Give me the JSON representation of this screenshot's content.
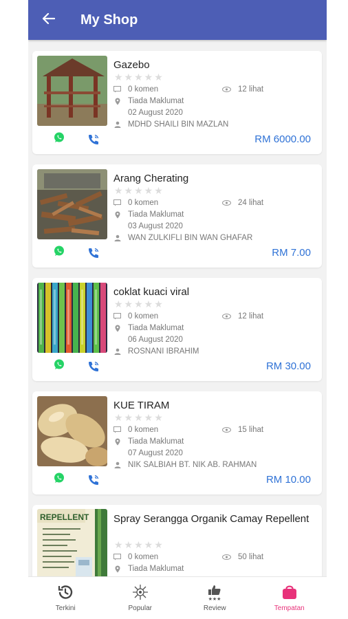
{
  "appbar": {
    "title": "My Shop",
    "back_icon": "arrow-left-icon"
  },
  "colors": {
    "appbar": "#4d5eb5",
    "price": "#2f72d6",
    "whatsapp": "#25d366",
    "call": "#2f72d6",
    "active_tab": "#e8327a"
  },
  "products": [
    {
      "name": "Gazebo",
      "comments": "0 komen",
      "views": "12 lihat",
      "location": "Tiada Maklumat",
      "date": "02 August 2020",
      "seller": "MDHD SHAILI BIN MAZLAN",
      "price": "RM 6000.00"
    },
    {
      "name": "Arang Cherating",
      "comments": "0 komen",
      "views": "24 lihat",
      "location": "Tiada Maklumat",
      "date": "03 August 2020",
      "seller": "WAN ZULKIFLI BIN WAN GHAFAR",
      "price": "RM 7.00"
    },
    {
      "name": "coklat kuaci viral",
      "comments": "0 komen",
      "views": "12 lihat",
      "location": "Tiada Maklumat",
      "date": "06 August 2020",
      "seller": "ROSNANI IBRAHIM",
      "price": "RM 30.00"
    },
    {
      "name": "KUE TIRAM",
      "comments": "0 komen",
      "views": "15 lihat",
      "location": "Tiada Maklumat",
      "date": "07 August 2020",
      "seller": "NIK SALBIAH BT. NIK AB. RAHMAN",
      "price": "RM 10.00"
    },
    {
      "name": "Spray Serangga Organik Camay Repellent",
      "comments": "0 komen",
      "views": "50 lihat",
      "location": "Tiada Maklumat",
      "thumb_text": "REPELLENT"
    }
  ],
  "nav": [
    {
      "label": "Terkini",
      "icon": "history-clock-icon"
    },
    {
      "label": "Popular",
      "icon": "sparkle-icon"
    },
    {
      "label": "Review",
      "icon": "thumbs-up-stars-icon"
    },
    {
      "label": "Tempatan",
      "icon": "shop-bag-icon"
    }
  ]
}
